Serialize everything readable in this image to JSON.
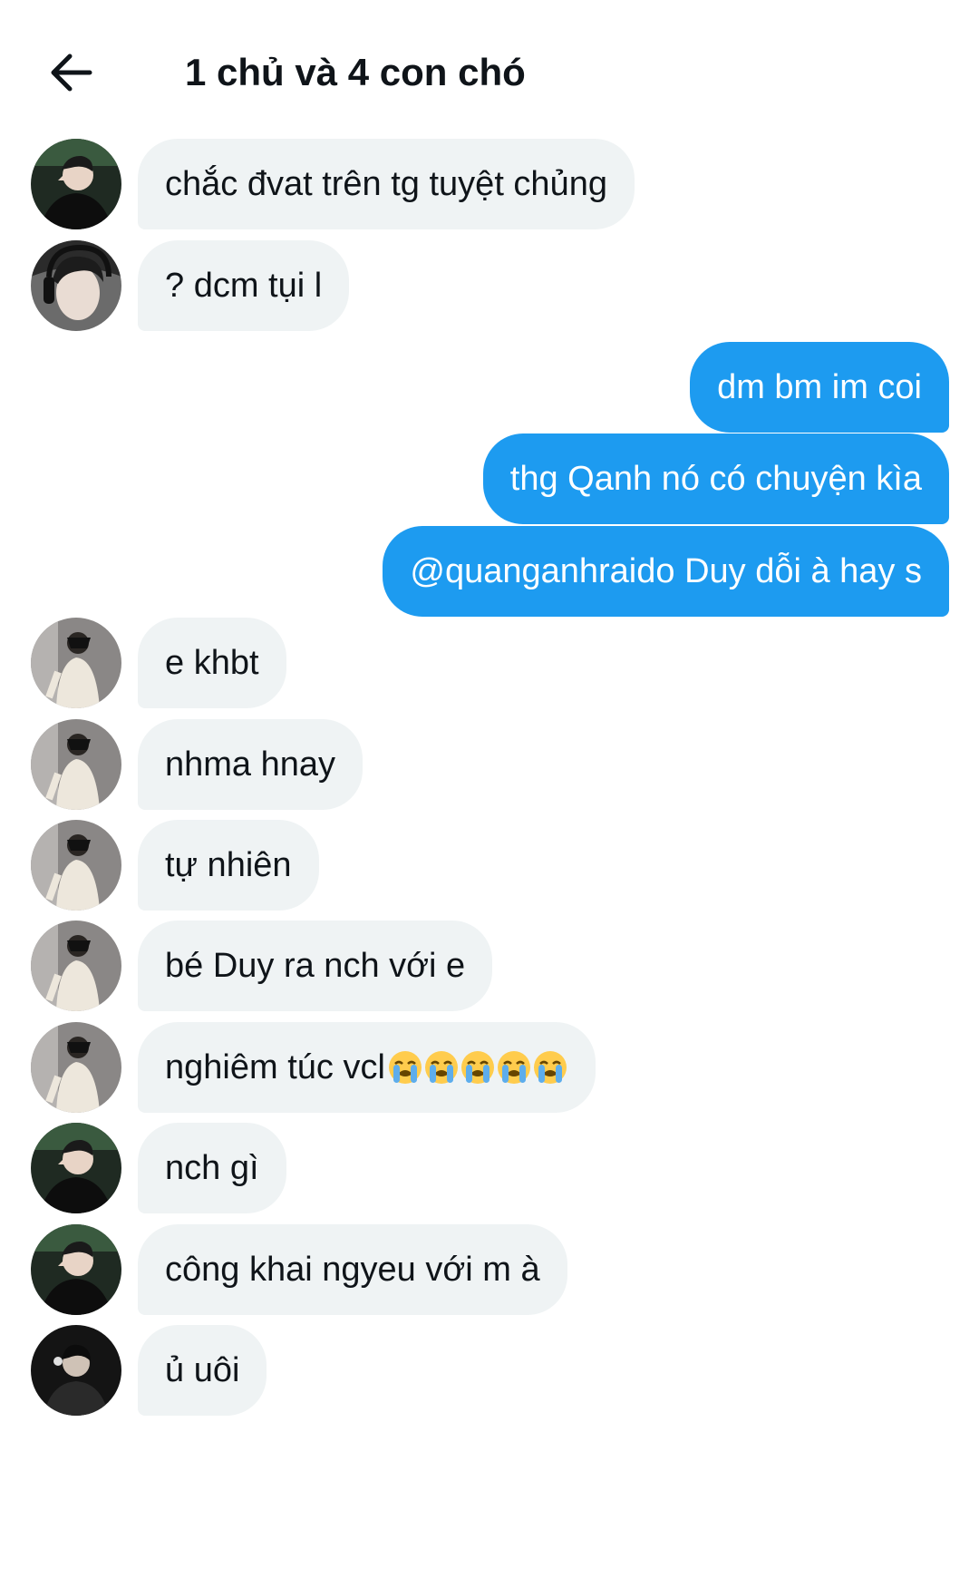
{
  "header": {
    "title": "1 chủ và 4 con chó",
    "back_icon": "arrow-left-icon"
  },
  "colors": {
    "outgoing_bubble": "#1d9bf0",
    "incoming_bubble": "#eff3f4",
    "text": "#0f1419"
  },
  "messages": [
    {
      "direction": "incoming",
      "avatar": "avatar-user-a",
      "text": "chắc đvat trên tg tuyệt chủng"
    },
    {
      "direction": "incoming",
      "avatar": "avatar-user-b",
      "text": "? dcm tụi l"
    },
    {
      "direction": "outgoing",
      "text": "dm bm im coi"
    },
    {
      "direction": "outgoing",
      "text": "thg Qanh nó có chuyện kìa"
    },
    {
      "direction": "outgoing",
      "text": "@quanganhraido Duy dỗi à hay s"
    },
    {
      "direction": "incoming",
      "avatar": "avatar-user-c",
      "text": "e khbt"
    },
    {
      "direction": "incoming",
      "avatar": "avatar-user-c",
      "text": "nhma hnay"
    },
    {
      "direction": "incoming",
      "avatar": "avatar-user-c",
      "text": "tự nhiên"
    },
    {
      "direction": "incoming",
      "avatar": "avatar-user-c",
      "text": "bé Duy ra nch với e"
    },
    {
      "direction": "incoming",
      "avatar": "avatar-user-c",
      "text": "nghiêm túc vcl",
      "emoji": "loudly-crying-face-icon",
      "emoji_count": 5
    },
    {
      "direction": "incoming",
      "avatar": "avatar-user-a",
      "text": "nch gì"
    },
    {
      "direction": "incoming",
      "avatar": "avatar-user-a",
      "text": "công khai ngyeu với m à"
    },
    {
      "direction": "incoming",
      "avatar": "avatar-user-d",
      "text": "ủ uôi"
    }
  ]
}
